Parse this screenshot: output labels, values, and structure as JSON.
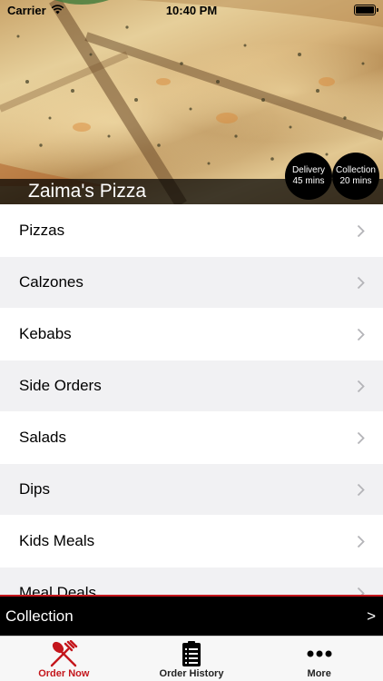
{
  "status_bar": {
    "carrier": "Carrier",
    "time": "10:40 PM"
  },
  "restaurant": {
    "name": "Zaima's Pizza",
    "delivery": {
      "label": "Delivery",
      "time": "45 mins"
    },
    "collection": {
      "label": "Collection",
      "time": "20 mins"
    }
  },
  "menu": {
    "items": [
      {
        "label": "Pizzas"
      },
      {
        "label": "Calzones"
      },
      {
        "label": "Kebabs"
      },
      {
        "label": "Side Orders"
      },
      {
        "label": "Salads"
      },
      {
        "label": "Dips"
      },
      {
        "label": "Kids Meals"
      },
      {
        "label": "Meal Deals"
      }
    ]
  },
  "collection_bar": {
    "label": "Collection",
    "arrow": ">"
  },
  "tab_bar": {
    "tabs": [
      {
        "label": "Order Now",
        "icon": "fork-knife-icon",
        "active": true
      },
      {
        "label": "Order History",
        "icon": "clipboard-list-icon",
        "active": false
      },
      {
        "label": "More",
        "icon": "more-dots-icon",
        "active": false
      }
    ]
  },
  "colors": {
    "accent": "#c4161c",
    "bar_background": "#000000",
    "alt_row": "#f1f1f3"
  }
}
